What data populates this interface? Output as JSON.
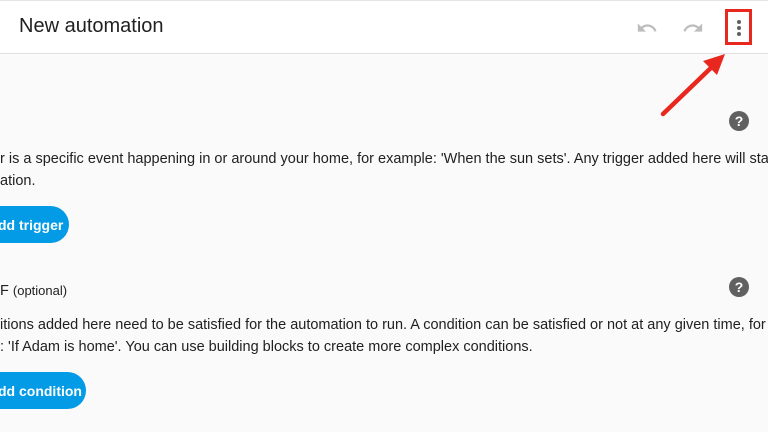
{
  "header": {
    "title": "New automation"
  },
  "triggers": {
    "description_line1": "r is a specific event happening in or around your home, for example: 'When the sun sets'. Any trigger added here will start your",
    "description_line2": "ation.",
    "add_button": "dd trigger",
    "help_glyph": "?"
  },
  "conditions": {
    "heading_fragment": "F",
    "optional_label": "(optional)",
    "description_line1": "itions added here need to be satisfied for the automation to run. A condition can be satisfied or not at any given time, for",
    "description_line2": ": 'If Adam is home'. You can use building blocks to create more complex conditions.",
    "add_button": "dd condition",
    "help_glyph": "?"
  },
  "colors": {
    "accent": "#039be5",
    "highlight": "#e8281e",
    "icon_disabled": "#bdbdbd",
    "icon_active": "#616161"
  },
  "icons": {
    "undo": "undo-icon",
    "redo": "redo-icon",
    "menu": "more-vertical-icon",
    "help": "help-circle-icon"
  }
}
